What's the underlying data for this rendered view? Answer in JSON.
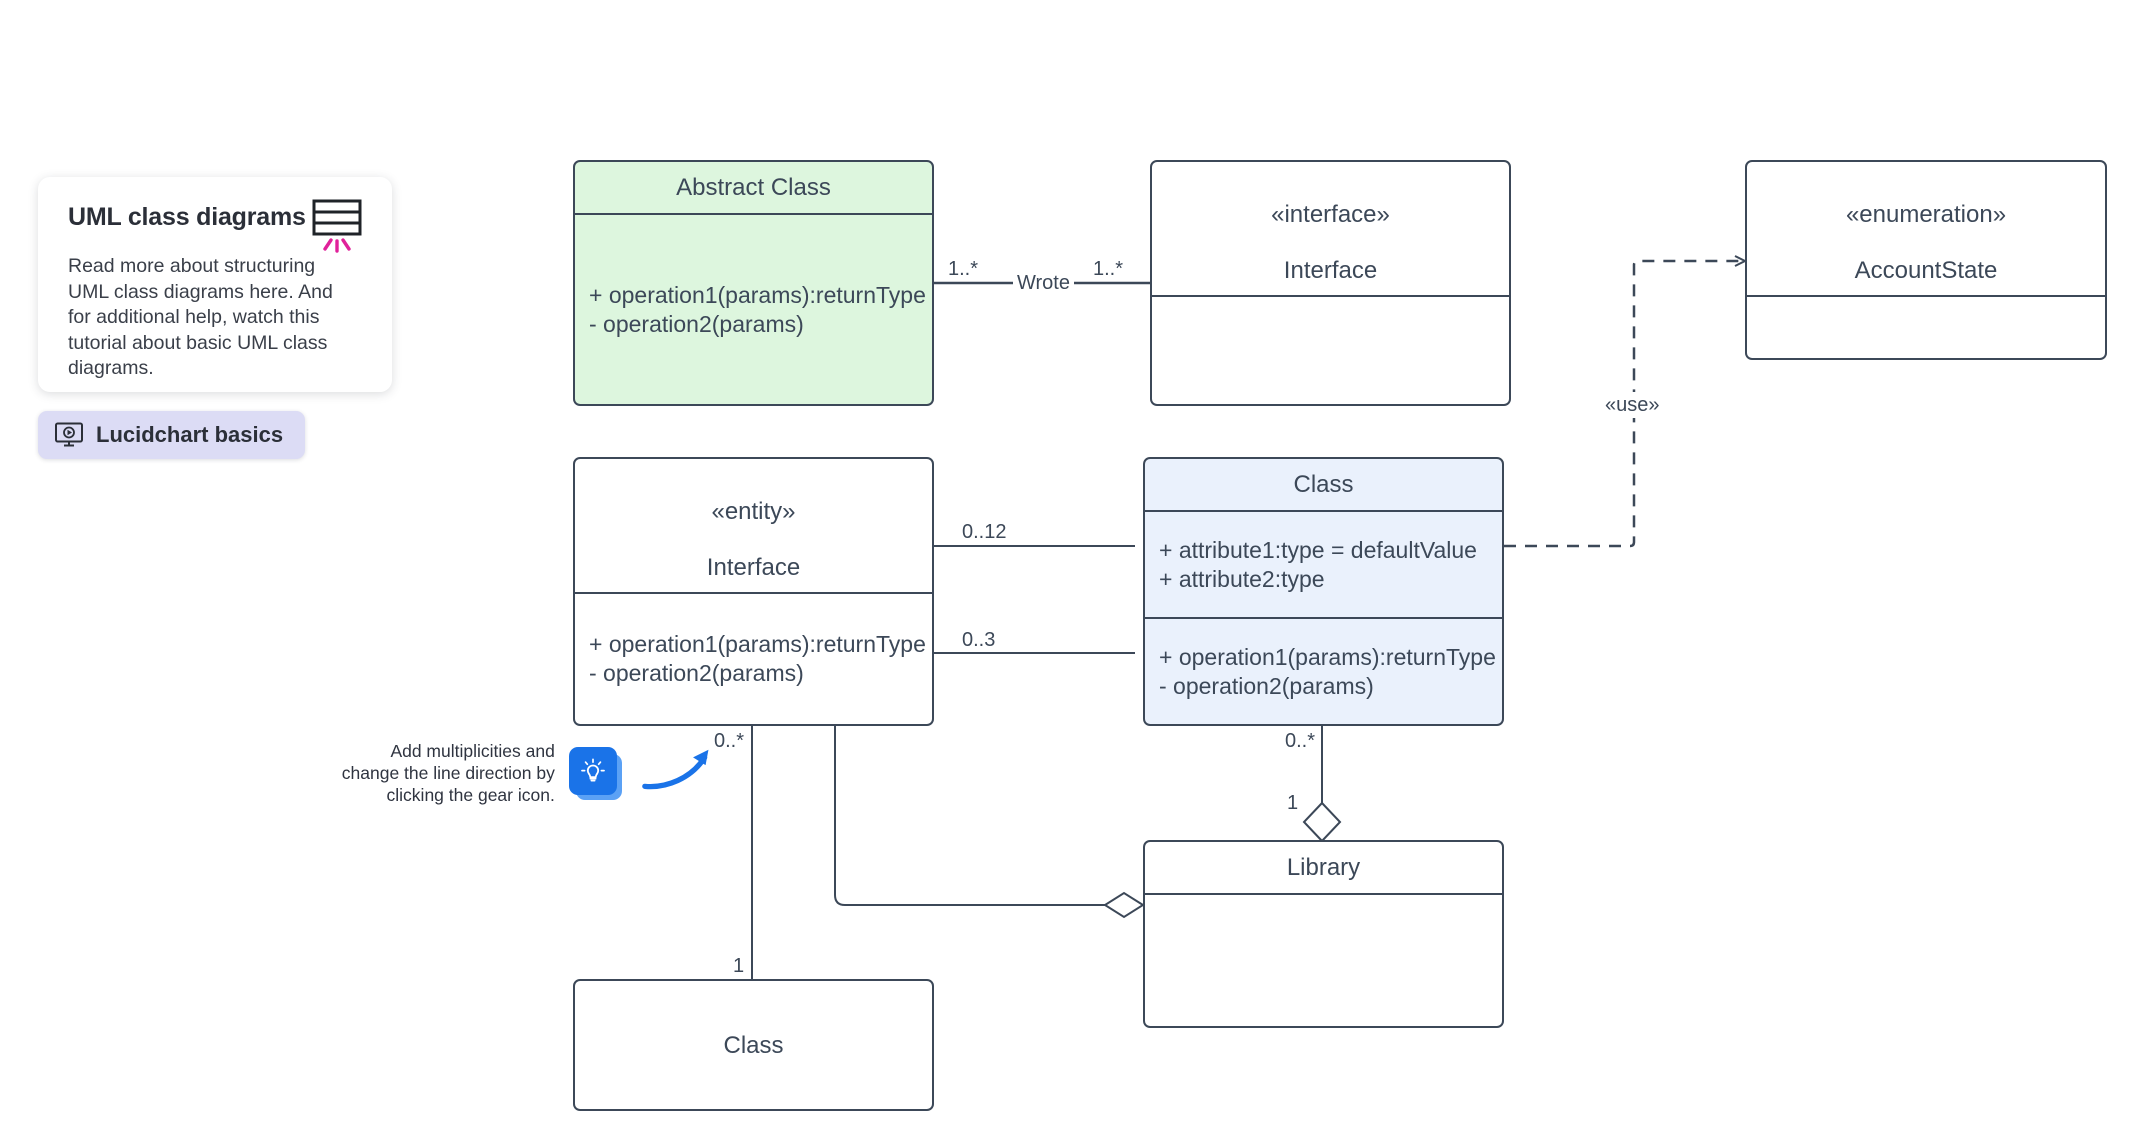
{
  "info_card": {
    "title": "UML class diagrams",
    "body": "Read more about structuring UML class diagrams here. And for additional help, watch this tutorial about basic UML class diagrams.",
    "icon": "uml-class-box-icon",
    "accent_color": "#e0219a"
  },
  "lucidchart_pill": {
    "label": "Lucidchart basics",
    "icon": "monitor-play-icon",
    "background_color": "#dcdcf5"
  },
  "hint": {
    "text": "Add multiplicities and change the line direction by clicking the gear icon.",
    "icon": "lightbulb-icon",
    "arrow_icon": "curved-arrow-icon",
    "accent_color": "#1a73e8"
  },
  "nodes": {
    "abstract_class": {
      "name": "abstract-class",
      "stereotype": "",
      "title": "Abstract Class",
      "fill": "#ddf6de",
      "compartments": [
        {
          "lines": [
            "+ operation1(params):returnType",
            "- operation2(params)"
          ]
        }
      ]
    },
    "interface_top": {
      "name": "interface",
      "stereotype": "«interface»",
      "title": "Interface",
      "fill": "#ffffff",
      "compartments": [
        {
          "lines": []
        }
      ]
    },
    "enumeration": {
      "name": "enumeration",
      "stereotype": "«enumeration»",
      "title": "AccountState",
      "fill": "#ffffff",
      "compartments": [
        {
          "lines": []
        }
      ]
    },
    "entity_interface": {
      "name": "entity-interface",
      "stereotype": "«entity»",
      "title": "Interface",
      "fill": "#ffffff",
      "compartments": [
        {
          "lines": [
            "+ operation1(params):returnType",
            "- operation2(params)"
          ]
        }
      ]
    },
    "class_blue": {
      "name": "class",
      "stereotype": "",
      "title": "Class",
      "fill": "#eaf1fc",
      "compartments": [
        {
          "lines": [
            "+ attribute1:type = defaultValue",
            "+ attribute2:type"
          ]
        },
        {
          "lines": [
            "+ operation1(params):returnType",
            "- operation2(params)"
          ]
        }
      ]
    },
    "library": {
      "name": "library",
      "stereotype": "",
      "title": "Library",
      "fill": "#ffffff",
      "compartments": [
        {
          "lines": []
        }
      ]
    },
    "class_bottom": {
      "name": "class-bottom",
      "stereotype": "",
      "title": "",
      "fill": "#ffffff",
      "center_label": "Class",
      "compartments": []
    }
  },
  "edges": {
    "wrote": {
      "label": "Wrote",
      "source_multiplicity": "1..*",
      "target_multiplicity": "1..*",
      "style": "association"
    },
    "use_dependency": {
      "label": "«use»",
      "style": "dashed-dependency",
      "arrowhead": "open"
    },
    "entity_to_class_a": {
      "multiplicity": "0..12",
      "style": "association"
    },
    "entity_to_class_b": {
      "multiplicity": "0..3",
      "style": "association"
    },
    "entity_to_classbottom": {
      "source_multiplicity": "0..*",
      "target_multiplicity": "1",
      "style": "association"
    },
    "class_to_library": {
      "source_multiplicity": "0..*",
      "target_multiplicity": "1",
      "style": "aggregation",
      "diamond": "hollow"
    },
    "entity_to_library": {
      "style": "aggregation",
      "diamond": "hollow"
    }
  },
  "theme": {
    "stroke": "#3c4858",
    "canvas_background": "#ffffff"
  }
}
